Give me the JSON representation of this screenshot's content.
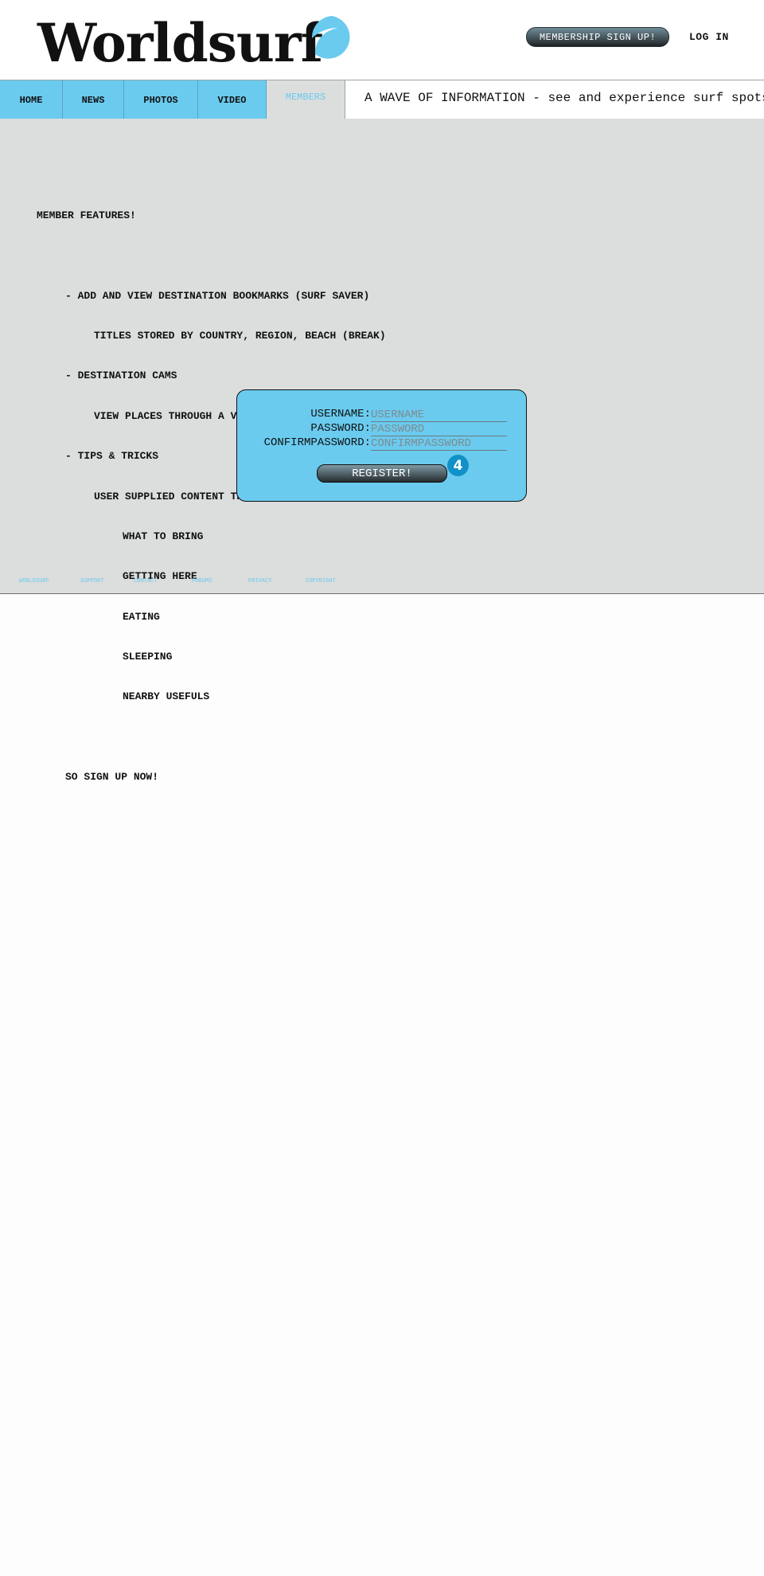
{
  "header": {
    "logo_text": "Worldsurf",
    "signup_label": "MEMBERSHIP SIGN UP!",
    "login_label": "LOG IN"
  },
  "nav": {
    "tabs": [
      {
        "label": "HOME"
      },
      {
        "label": "NEWS"
      },
      {
        "label": "PHOTOS"
      },
      {
        "label": "VIDEO"
      },
      {
        "label": "MEMBERS",
        "active": true
      }
    ],
    "tagline": "A WAVE OF INFORMATION - see and experience surf spots"
  },
  "features": {
    "heading": "MEMBER FEATURES!",
    "bookmarks": "- ADD AND VIEW DESTINATION BOOKMARKS (SURF SAVER)",
    "bookmarks_detail": "TITLES STORED BY COUNTRY, REGION, BEACH (BREAK)",
    "cams": "- DESTINATION CAMS",
    "cams_detail": "VIEW PLACES THROUGH A VIDEO TO BETTER PICTURE YOURSELF IN IT",
    "tips": "- TIPS & TRICKS",
    "tips_detail": "USER SUPPLIED CONTENT THAT CAN HELP BETTER SERVE YOUR NEEDS:",
    "tips_items": [
      "WHAT TO BRING",
      "GETTING HERE",
      "EATING",
      "SLEEPING",
      "NEARBY USEFULS"
    ],
    "cta": "SO SIGN UP NOW!"
  },
  "register": {
    "username_label": "USERNAME:",
    "username_placeholder": "USERNAME",
    "password_label": "PASSWORD:",
    "password_placeholder": "PASSWORD",
    "confirm_label": "CONFIRMPASSWORD:",
    "confirm_placeholder": "CONFIRMPASSWORD",
    "button_label": "REGISTER!",
    "step_badge": "4"
  },
  "footer": {
    "links": [
      "WORLDSURF",
      "SUPPORT",
      "CONTACT",
      "FORUMS",
      "PRIVACY",
      "COPYRIGHT"
    ]
  },
  "colors": {
    "accent": "#6acbef",
    "main_bg": "#dcdddd",
    "badge": "#1191c7"
  },
  "icons": {
    "logo": "wave-logo-icon"
  }
}
